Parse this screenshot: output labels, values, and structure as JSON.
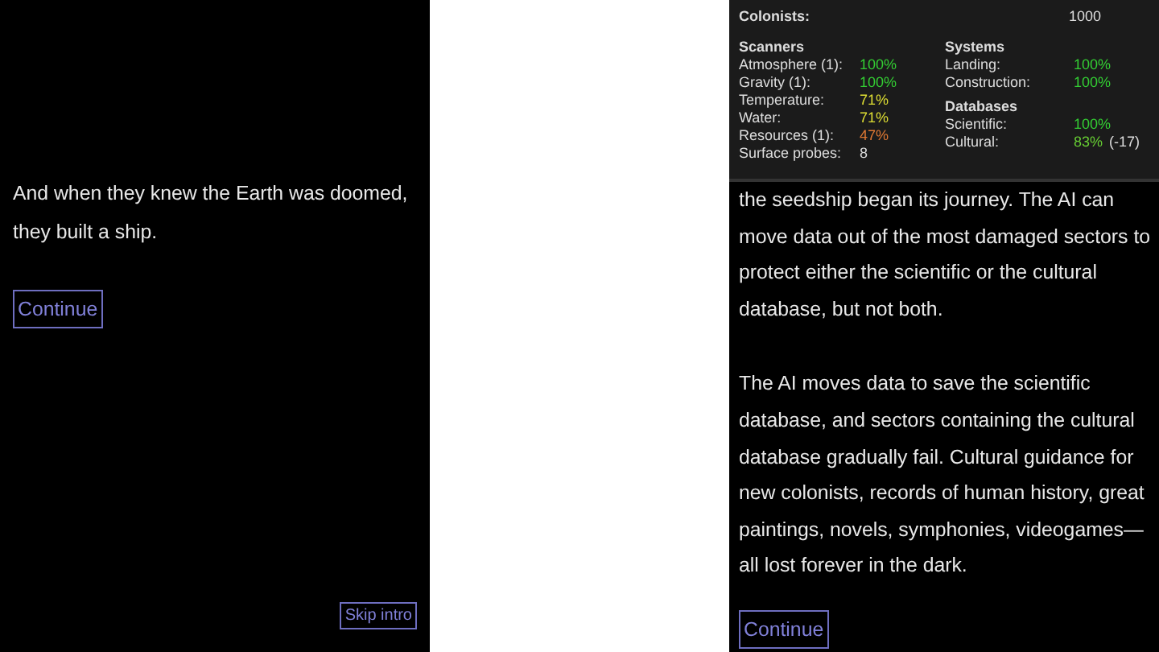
{
  "intro_panel": {
    "text": "And when they knew the Earth was doomed, they built a ship.",
    "continue_button": "Continue",
    "skip_button": "Skip intro"
  },
  "story_panel": {
    "stats": {
      "colonists_label": "Colonists:",
      "colonists_value": "1000",
      "scanners": {
        "heading": "Scanners",
        "rows": [
          {
            "label": "Atmosphere (1):",
            "value": "100%",
            "color": "#33cc33"
          },
          {
            "label": "Gravity (1):",
            "value": "100%",
            "color": "#33cc33"
          },
          {
            "label": "Temperature:",
            "value": "71%",
            "color": "#dddd33"
          },
          {
            "label": "Water:",
            "value": "71%",
            "color": "#dddd33"
          },
          {
            "label": "Resources (1):",
            "value": "47%",
            "color": "#dd7733"
          },
          {
            "label": "Surface probes:",
            "value": "8",
            "color": "#dddddd"
          }
        ]
      },
      "systems": {
        "heading": "Systems",
        "rows": [
          {
            "label": "Landing:",
            "value": "100%",
            "color": "#33cc33"
          },
          {
            "label": "Construction:",
            "value": "100%",
            "color": "#33cc33"
          }
        ]
      },
      "databases": {
        "heading": "Databases",
        "rows": [
          {
            "label": "Scientific:",
            "value": "100%",
            "color": "#33cc33"
          },
          {
            "label": "Cultural:",
            "value": "83%",
            "color": "#66cc33",
            "change": "(-17)"
          }
        ]
      }
    },
    "paragraphs": [
      "the seedship began its journey. The AI can move data out of the most damaged sectors to protect either the scientific or the cultural database, but not both.",
      "The AI moves data to save the scientific database, and sectors containing the cultural database gradually fail. Cultural guidance for new colonists, records of human history, great paintings, novels, symphonies, videogames—all lost forever in the dark."
    ],
    "continue_button": "Continue"
  }
}
